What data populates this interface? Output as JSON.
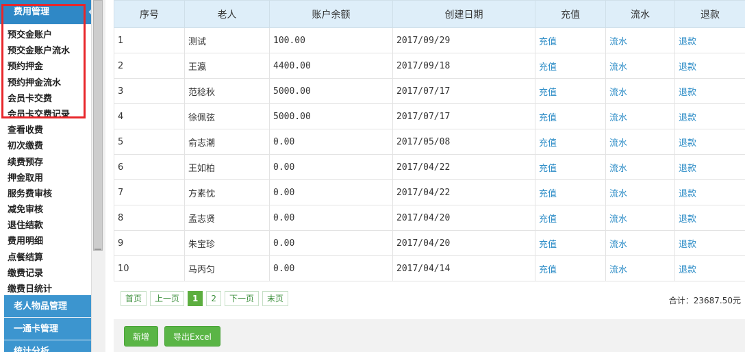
{
  "sidebar": {
    "top_header": "费用管理",
    "menu": [
      "预交金账户",
      "预交金账户流水",
      "预约押金",
      "预约押金流水",
      "会员卡交费",
      "会员卡交费记录",
      "查看收费",
      "初次缴费",
      "续费预存",
      "押金取用",
      "服务费审核",
      "减免审核",
      "退住结款",
      "费用明细",
      "点餐结算",
      "缴费记录",
      "缴费日统计"
    ],
    "lower_headers": [
      "老人物品管理",
      "一通卡管理",
      "统计分析"
    ]
  },
  "table": {
    "headers": [
      "序号",
      "老人",
      "账户余额",
      "创建日期",
      "充值",
      "流水",
      "退款"
    ],
    "rows": [
      {
        "no": "1",
        "name": "测试",
        "balance": "100.00",
        "date": "2017/09/29",
        "recharge": "充值",
        "flow": "流水",
        "refund": "退款"
      },
      {
        "no": "2",
        "name": "王瀛",
        "balance": "4400.00",
        "date": "2017/09/18",
        "recharge": "充值",
        "flow": "流水",
        "refund": "退款"
      },
      {
        "no": "3",
        "name": "范稔秋",
        "balance": "5000.00",
        "date": "2017/07/17",
        "recharge": "充值",
        "flow": "流水",
        "refund": "退款"
      },
      {
        "no": "4",
        "name": "徐佩弦",
        "balance": "5000.00",
        "date": "2017/07/17",
        "recharge": "充值",
        "flow": "流水",
        "refund": "退款"
      },
      {
        "no": "5",
        "name": "俞志潮",
        "balance": "0.00",
        "date": "2017/05/08",
        "recharge": "充值",
        "flow": "流水",
        "refund": "退款"
      },
      {
        "no": "6",
        "name": "王如柏",
        "balance": "0.00",
        "date": "2017/04/22",
        "recharge": "充值",
        "flow": "流水",
        "refund": "退款"
      },
      {
        "no": "7",
        "name": "方素忱",
        "balance": "0.00",
        "date": "2017/04/22",
        "recharge": "充值",
        "flow": "流水",
        "refund": "退款"
      },
      {
        "no": "8",
        "name": "孟志贤",
        "balance": "0.00",
        "date": "2017/04/20",
        "recharge": "充值",
        "flow": "流水",
        "refund": "退款"
      },
      {
        "no": "9",
        "name": "朱宝珍",
        "balance": "0.00",
        "date": "2017/04/20",
        "recharge": "充值",
        "flow": "流水",
        "refund": "退款"
      },
      {
        "no": "10",
        "name": "马丙匀",
        "balance": "0.00",
        "date": "2017/04/14",
        "recharge": "充值",
        "flow": "流水",
        "refund": "退款"
      }
    ]
  },
  "pager": {
    "first": "首页",
    "prev": "上一页",
    "page1": "1",
    "page2": "2",
    "next": "下一页",
    "last": "末页"
  },
  "total": "合计：23687.50元",
  "buttons": {
    "add": "新增",
    "export": "导出Excel"
  }
}
